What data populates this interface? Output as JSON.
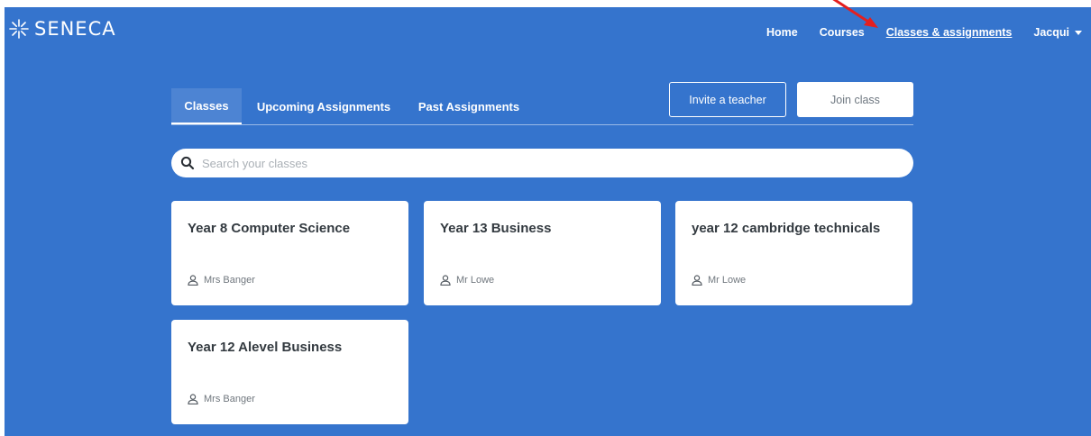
{
  "header": {
    "brand": "SENECA",
    "nav": {
      "home": "Home",
      "courses": "Courses",
      "classes": "Classes & assignments",
      "user": "Jacqui"
    }
  },
  "tabs": {
    "classes": "Classes",
    "upcoming": "Upcoming Assignments",
    "past": "Past Assignments"
  },
  "actions": {
    "invite": "Invite a teacher",
    "join": "Join class"
  },
  "search": {
    "placeholder": "Search your classes",
    "value": ""
  },
  "classes": [
    {
      "title": "Year 8 Computer Science",
      "teacher": "Mrs Banger"
    },
    {
      "title": "Year 13 Business",
      "teacher": "Mr Lowe"
    },
    {
      "title": "year 12 cambridge technicals",
      "teacher": "Mr Lowe"
    },
    {
      "title": "Year 12 Alevel Business",
      "teacher": "Mrs Banger"
    }
  ],
  "colors": {
    "background": "#3574cd",
    "card": "#ffffff",
    "annotation_arrow": "#e41f1f"
  },
  "icons": {
    "logo": "seneca-logo-icon",
    "search": "search-icon",
    "teacher": "person-icon",
    "dropdown": "chevron-down-icon"
  }
}
